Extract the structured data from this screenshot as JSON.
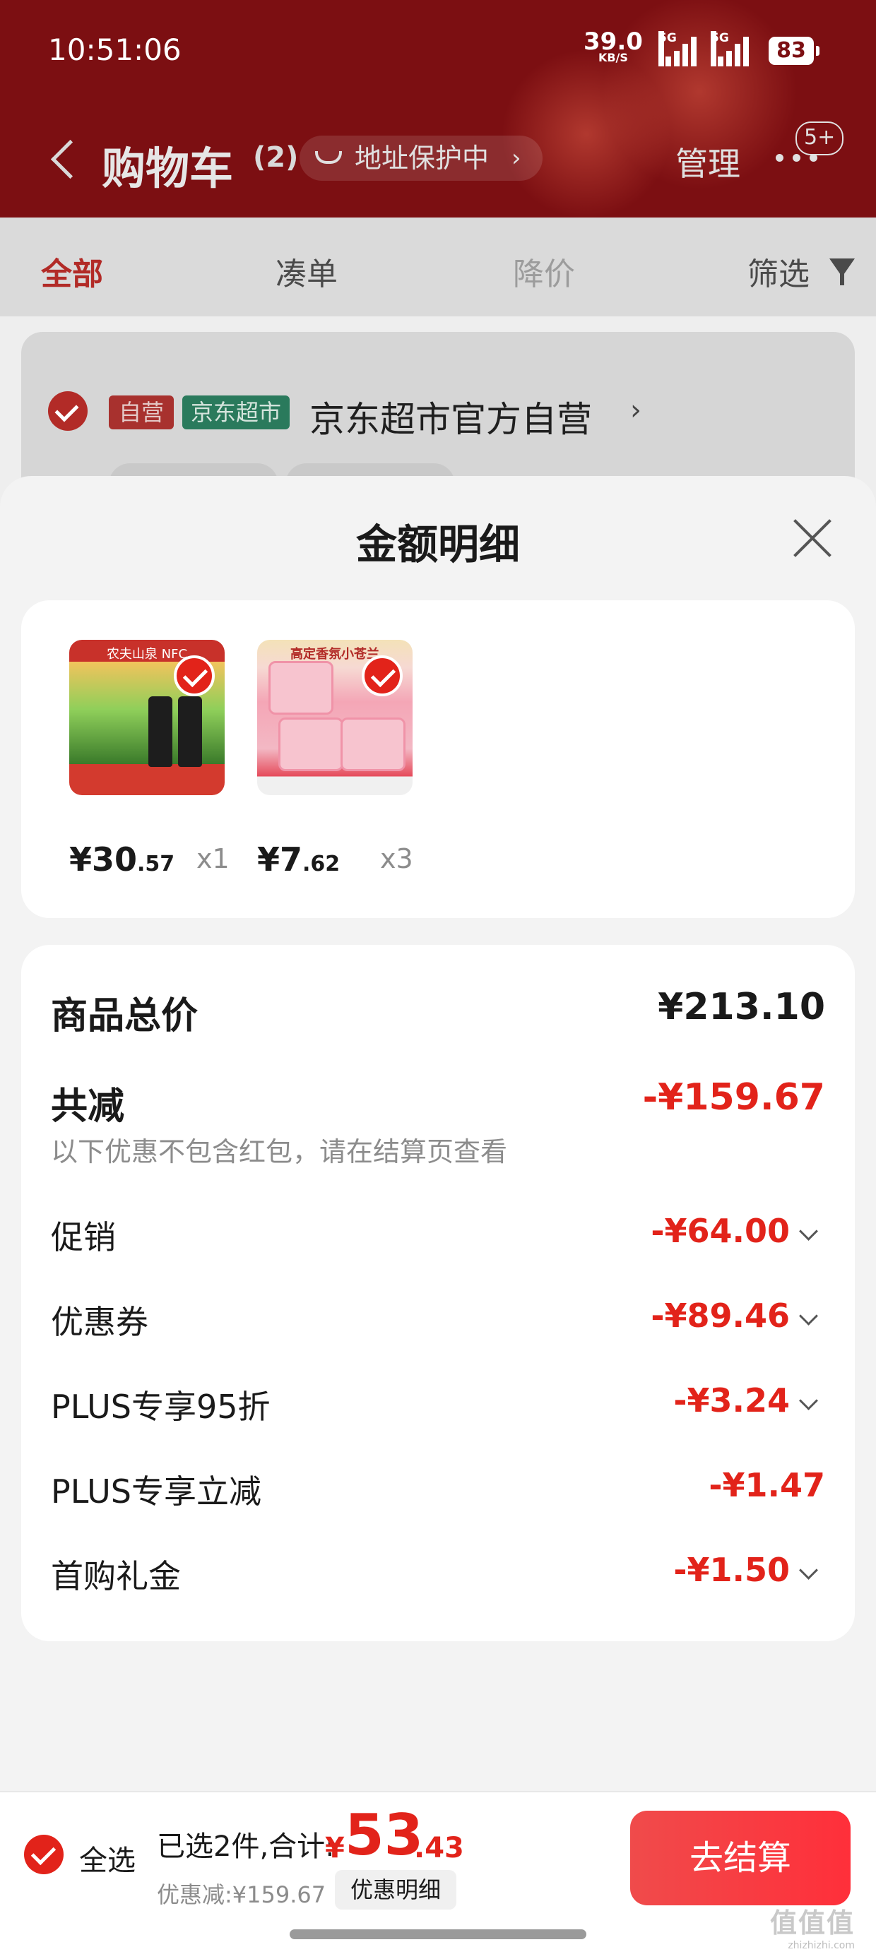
{
  "status_bar": {
    "time": "10:51:06",
    "net_speed": "39.0",
    "net_unit": "KB/S",
    "sim_labels": [
      "5G",
      "5G"
    ],
    "battery": "83"
  },
  "header": {
    "title": "购物车",
    "count": "(2)",
    "address_protect": "地址保护中",
    "address_chevron": "›",
    "manage": "管理",
    "more_badge": "5+"
  },
  "tabs": [
    {
      "label": "全部",
      "state": "active"
    },
    {
      "label": "凑单",
      "state": "normal"
    },
    {
      "label": "降价",
      "state": "disabled"
    },
    {
      "label": "筛选",
      "state": "normal"
    }
  ],
  "store": {
    "tag_self": "自营",
    "tag_jd": "京东超市",
    "name": "京东超市官方自营",
    "chevron": "›"
  },
  "sheet": {
    "title": "金额明细",
    "products": [
      {
        "image_text": "农夫山泉 NFC",
        "price_int": "¥30",
        "price_dec": ".57",
        "qty": "x1"
      },
      {
        "image_text": "高定香氛小苍兰",
        "price_int": "¥7",
        "price_dec": ".62",
        "qty": "x3"
      }
    ],
    "total_label": "商品总价",
    "total_value": "¥213.10",
    "reduce_label": "共减",
    "reduce_value": "-¥159.67",
    "reduce_note": "以下优惠不包含红包，请在结算页查看",
    "items": [
      {
        "label": "促销",
        "value": "-¥64.00",
        "expandable": true
      },
      {
        "label": "优惠券",
        "value": "-¥89.46",
        "expandable": true
      },
      {
        "label": "PLUS专享95折",
        "value": "-¥3.24",
        "expandable": true
      },
      {
        "label": "PLUS专享立减",
        "value": "-¥1.47",
        "expandable": false
      },
      {
        "label": "首购礼金",
        "value": "-¥1.50",
        "expandable": true
      }
    ]
  },
  "footer": {
    "select_all": "全选",
    "selected_sum_label": "已选2件,合计:",
    "sum_currency": "¥",
    "sum_int": "53",
    "sum_dec": ".43",
    "discount_text": "优惠减:¥159.67",
    "promo_detail": "优惠明细",
    "checkout": "去结算"
  },
  "watermark": {
    "text": "值值值",
    "sub": "zhizhizhi.com"
  },
  "colors": {
    "accent": "#e2231a",
    "header_bg": "#7c0f12",
    "checkout": "#ff2f3a"
  }
}
